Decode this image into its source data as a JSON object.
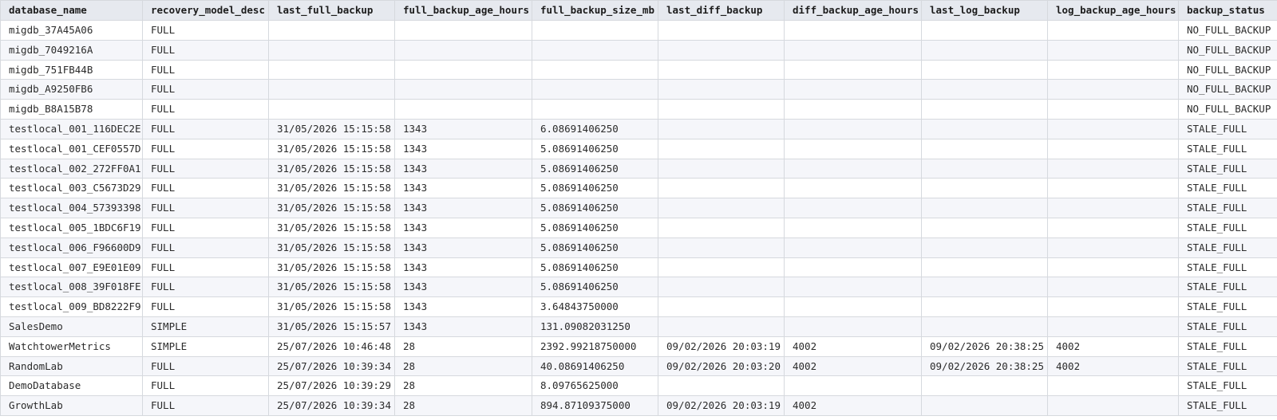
{
  "grid": {
    "columns": [
      "database_name",
      "recovery_model_desc",
      "last_full_backup",
      "full_backup_age_hours",
      "full_backup_size_mb",
      "last_diff_backup",
      "diff_backup_age_hours",
      "last_log_backup",
      "log_backup_age_hours",
      "backup_status"
    ],
    "rows": [
      [
        "migdb_37A45A06",
        "FULL",
        "",
        "",
        "",
        "",
        "",
        "",
        "",
        "NO_FULL_BACKUP"
      ],
      [
        "migdb_7049216A",
        "FULL",
        "",
        "",
        "",
        "",
        "",
        "",
        "",
        "NO_FULL_BACKUP"
      ],
      [
        "migdb_751FB44B",
        "FULL",
        "",
        "",
        "",
        "",
        "",
        "",
        "",
        "NO_FULL_BACKUP"
      ],
      [
        "migdb_A9250FB6",
        "FULL",
        "",
        "",
        "",
        "",
        "",
        "",
        "",
        "NO_FULL_BACKUP"
      ],
      [
        "migdb_B8A15B78",
        "FULL",
        "",
        "",
        "",
        "",
        "",
        "",
        "",
        "NO_FULL_BACKUP"
      ],
      [
        "testlocal_001_116DEC2E",
        "FULL",
        "31/05/2026 15:15:58",
        "1343",
        "6.08691406250",
        "",
        "",
        "",
        "",
        "STALE_FULL"
      ],
      [
        "testlocal_001_CEF0557D",
        "FULL",
        "31/05/2026 15:15:58",
        "1343",
        "5.08691406250",
        "",
        "",
        "",
        "",
        "STALE_FULL"
      ],
      [
        "testlocal_002_272FF0A1",
        "FULL",
        "31/05/2026 15:15:58",
        "1343",
        "5.08691406250",
        "",
        "",
        "",
        "",
        "STALE_FULL"
      ],
      [
        "testlocal_003_C5673D29",
        "FULL",
        "31/05/2026 15:15:58",
        "1343",
        "5.08691406250",
        "",
        "",
        "",
        "",
        "STALE_FULL"
      ],
      [
        "testlocal_004_57393398",
        "FULL",
        "31/05/2026 15:15:58",
        "1343",
        "5.08691406250",
        "",
        "",
        "",
        "",
        "STALE_FULL"
      ],
      [
        "testlocal_005_1BDC6F19",
        "FULL",
        "31/05/2026 15:15:58",
        "1343",
        "5.08691406250",
        "",
        "",
        "",
        "",
        "STALE_FULL"
      ],
      [
        "testlocal_006_F96600D9",
        "FULL",
        "31/05/2026 15:15:58",
        "1343",
        "5.08691406250",
        "",
        "",
        "",
        "",
        "STALE_FULL"
      ],
      [
        "testlocal_007_E9E01E09",
        "FULL",
        "31/05/2026 15:15:58",
        "1343",
        "5.08691406250",
        "",
        "",
        "",
        "",
        "STALE_FULL"
      ],
      [
        "testlocal_008_39F018FE",
        "FULL",
        "31/05/2026 15:15:58",
        "1343",
        "5.08691406250",
        "",
        "",
        "",
        "",
        "STALE_FULL"
      ],
      [
        "testlocal_009_BD8222F9",
        "FULL",
        "31/05/2026 15:15:58",
        "1343",
        "3.64843750000",
        "",
        "",
        "",
        "",
        "STALE_FULL"
      ],
      [
        "SalesDemo",
        "SIMPLE",
        "31/05/2026 15:15:57",
        "1343",
        "131.09082031250",
        "",
        "",
        "",
        "",
        "STALE_FULL"
      ],
      [
        "WatchtowerMetrics",
        "SIMPLE",
        "25/07/2026 10:46:48",
        "28",
        "2392.99218750000",
        "09/02/2026 20:03:19",
        "4002",
        "09/02/2026 20:38:25",
        "4002",
        "STALE_FULL"
      ],
      [
        "RandomLab",
        "FULL",
        "25/07/2026 10:39:34",
        "28",
        "40.08691406250",
        "09/02/2026 20:03:20",
        "4002",
        "09/02/2026 20:38:25",
        "4002",
        "STALE_FULL"
      ],
      [
        "DemoDatabase",
        "FULL",
        "25/07/2026 10:39:29",
        "28",
        "8.09765625000",
        "",
        "",
        "",
        "",
        "STALE_FULL"
      ],
      [
        "GrowthLab",
        "FULL",
        "25/07/2026 10:39:34",
        "28",
        "894.87109375000",
        "09/02/2026 20:03:19",
        "4002",
        "",
        "",
        "STALE_FULL"
      ]
    ]
  }
}
